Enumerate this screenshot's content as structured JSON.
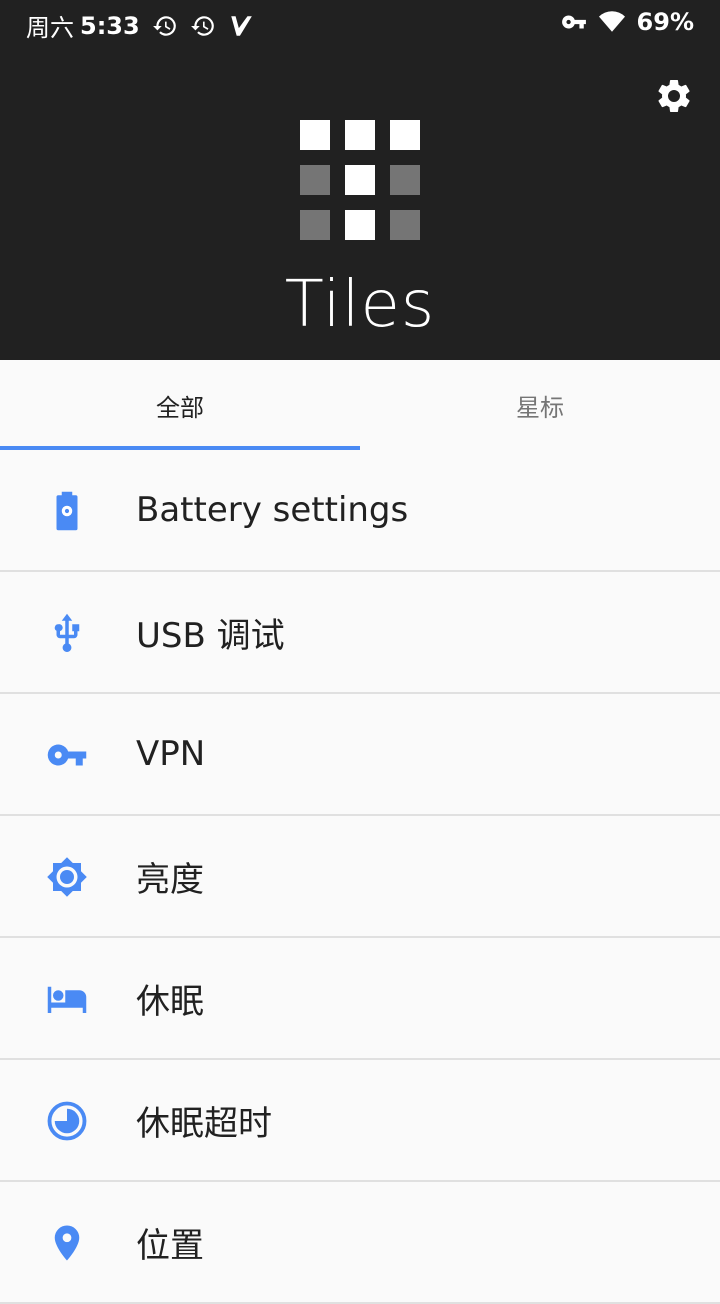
{
  "status_bar": {
    "time_prefix": "周六",
    "time": "5:33",
    "battery": "69%"
  },
  "app": {
    "title": "Tiles"
  },
  "tabs": [
    {
      "label": "全部",
      "active": true
    },
    {
      "label": "星标",
      "active": false
    }
  ],
  "tiles": [
    {
      "label": "Battery settings",
      "icon": "battery-settings-icon"
    },
    {
      "label": "USB 调试",
      "icon": "usb-icon"
    },
    {
      "label": "VPN",
      "icon": "vpn-key-icon"
    },
    {
      "label": "亮度",
      "icon": "brightness-icon"
    },
    {
      "label": "休眠",
      "icon": "sleep-bed-icon"
    },
    {
      "label": "休眠超时",
      "icon": "timeout-icon"
    },
    {
      "label": "位置",
      "icon": "location-icon"
    }
  ],
  "colors": {
    "accent": "#4a8af4",
    "header_bg": "#212121",
    "list_bg": "#fafafa"
  }
}
